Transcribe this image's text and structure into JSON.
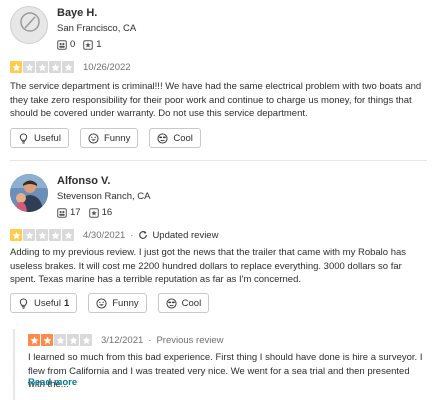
{
  "reviews": [
    {
      "user": {
        "name": "Baye H.",
        "location": "San Francisco, CA",
        "friends": "0",
        "reviews": "1"
      },
      "rating": 1,
      "date": "10/26/2022",
      "text": "The service department  is criminal!!!  We have had the same electrical problem with two boats and they take zero responsibility for their poor work and continue to charge us money, for things that should be covered under warranty.  Do not use this service department.",
      "buttons": {
        "useful": "Useful",
        "funny": "Funny",
        "cool": "Cool"
      }
    },
    {
      "user": {
        "name": "Alfonso V.",
        "location": "Stevenson Ranch, CA",
        "friends": "17",
        "reviews": "16"
      },
      "rating": 1,
      "date": "4/30/2021",
      "updated_label": "Updated review",
      "text": "Adding to my previous review.  I just got the news that the trailer that came with my Robalo has useless brakes.  It will cost me 2200 hundred dollars to replace everything.   3000 dollars so far spent.  Texas marine  has a terrible reputation as far as I'm concerned.",
      "buttons": {
        "useful": "Useful",
        "useful_count": "1",
        "funny": "Funny",
        "cool": "Cool"
      }
    }
  ],
  "previous_review": {
    "rating": 2,
    "date": "3/12/2021",
    "label": "Previous review",
    "text": "I learned so much from this bad experience.  First thing I should have done is hire a surveyor.  I flew from California and I was treated very nice.  We went for a sea trial and then presented with the...",
    "read_more": "Read more"
  },
  "colors": {
    "star_filled_1": "#ffcc4b",
    "star_filled_2": "#ff8b4b",
    "star_empty": "#d9d9d9",
    "link": "#027a97"
  },
  "icons": [
    "friends-icon",
    "reviews-icon",
    "useful-icon",
    "funny-icon",
    "cool-icon",
    "updated-icon",
    "star-icon"
  ]
}
